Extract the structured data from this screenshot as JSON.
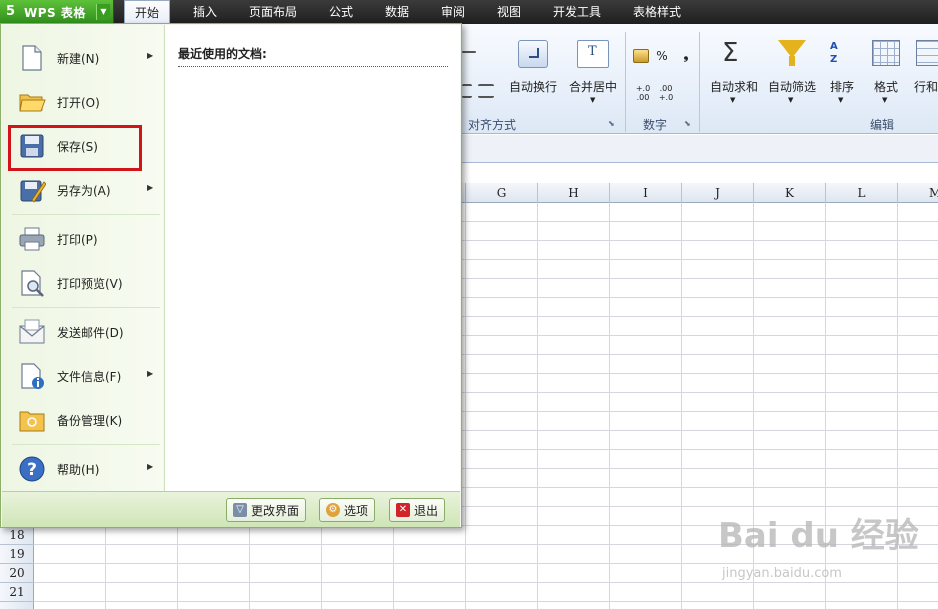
{
  "app": {
    "title": "WPS 表格"
  },
  "tabs": [
    "开始",
    "插入",
    "页面布局",
    "公式",
    "数据",
    "审阅",
    "视图",
    "开发工具",
    "表格样式"
  ],
  "ribbon": {
    "buttons": [
      "自动换行",
      "合并居中",
      "自动求和",
      "自动筛选",
      "排序",
      "格式",
      "行和"
    ],
    "groups": [
      "对齐方式",
      "数字",
      "编辑"
    ],
    "number_symbols": {
      "percent": "%",
      "comma": "❟",
      "inc_decimal": "+.0\n.00",
      "dec_decimal": ".00\n+.0"
    }
  },
  "grid": {
    "columns": [
      "G",
      "H",
      "I",
      "J",
      "K",
      "L",
      "M"
    ],
    "rows": [
      "18",
      "19",
      "20",
      "21"
    ]
  },
  "menu": {
    "items": [
      {
        "label": "新建(N)",
        "has_submenu": true,
        "icon": "new-document-icon"
      },
      {
        "label": "打开(O)",
        "has_submenu": false,
        "icon": "open-folder-icon"
      },
      {
        "label": "保存(S)",
        "has_submenu": false,
        "icon": "floppy-disk-icon"
      },
      {
        "label": "另存为(A)",
        "has_submenu": true,
        "icon": "save-as-icon"
      },
      {
        "label": "打印(P)",
        "has_submenu": false,
        "icon": "printer-icon"
      },
      {
        "label": "打印预览(V)",
        "has_submenu": false,
        "icon": "print-preview-icon"
      },
      {
        "label": "发送邮件(D)",
        "has_submenu": false,
        "icon": "envelope-icon"
      },
      {
        "label": "文件信息(F)",
        "has_submenu": true,
        "icon": "file-info-icon"
      },
      {
        "label": "备份管理(K)",
        "has_submenu": false,
        "icon": "backup-folder-icon"
      },
      {
        "label": "帮助(H)",
        "has_submenu": true,
        "icon": "help-icon"
      }
    ],
    "recent_title": "最近使用的文档:",
    "footer": {
      "change_ui": "更改界面",
      "options": "选项",
      "exit": "退出"
    }
  },
  "watermark": {
    "logo": "Bai du 经验",
    "url": "jingyan.baidu.com"
  },
  "colors": {
    "accent_green": "#3ea425",
    "highlight_red": "#d0141a"
  }
}
